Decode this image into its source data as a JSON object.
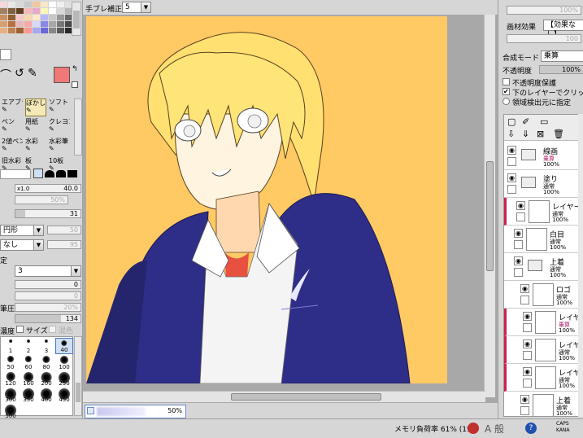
{
  "top_bar": {
    "stabilizer_label": "手ブレ補正",
    "stabilizer_value": "5"
  },
  "left_panel": {
    "swatch_colors": [
      "#f8d8d8",
      "#e8e8e8",
      "#d8d8d8",
      "#c8c8c8",
      "#f0c8a0",
      "#f8e8c8",
      "#ffffff",
      "#f0f0f0",
      "#e0e0e0",
      "#a08060",
      "#806040",
      "#604020",
      "#f8b8b8",
      "#e8a8c8",
      "#f8f8b8",
      "#ffffff",
      "#d8d8d8",
      "#b8b8b8",
      "#c89060",
      "#906030",
      "#f8c8c8",
      "#f8d8a8",
      "#ffe8c8",
      "#b8b8f8",
      "#c8c8c8",
      "#989898",
      "#686868",
      "#d8a070",
      "#b87040",
      "#e8b8b8",
      "#f8a8a8",
      "#d8d8f8",
      "#8888e8",
      "#a8a8a8",
      "#787878",
      "#484848",
      "#e8b080",
      "#c08050",
      "#a06030",
      "#f89898",
      "#a8a8f0",
      "#6868d8",
      "#888888",
      "#585858",
      "#282828"
    ],
    "main_color": "#f07878",
    "tools": [
      {
        "label": "エアブラシ",
        "active": false
      },
      {
        "label": "ぼかし",
        "active": true
      },
      {
        "label": "ソフト",
        "active": false
      },
      {
        "label": "ペン",
        "active": false
      },
      {
        "label": "用紙",
        "active": false
      },
      {
        "label": "クレヨン",
        "active": false
      },
      {
        "label": "2値ペン",
        "active": false
      },
      {
        "label": "水彩",
        "active": false
      },
      {
        "label": "水彩筆",
        "active": false
      },
      {
        "label": "旧水彩",
        "active": false
      },
      {
        "label": "板",
        "active": false
      },
      {
        "label": "10板",
        "active": false
      }
    ],
    "size_multiplier": "x1.0",
    "size_value": "40.0",
    "min_size_value": "50%",
    "density_value": "31",
    "shape_select": "円形",
    "shape_strength": "50",
    "texture_select": "なし",
    "texture_strength": "95",
    "blend_label": "定",
    "blend_value": "3",
    "slider_a_value": "0",
    "slider_b_value": "0",
    "pressure_label": "筆圧",
    "pressure_value": "20%",
    "pressure2_value": "134",
    "density_label": "濃度",
    "size_check_label": "サイズ",
    "mix_check_label": "混色",
    "brush_sizes": [
      "1",
      "2",
      "3",
      "40",
      "50",
      "60",
      "80",
      "100",
      "120",
      "160",
      "200",
      "250",
      "300",
      "350",
      "400",
      "450",
      "500"
    ]
  },
  "navigator": {
    "zoom_pct": "50%"
  },
  "right_panel": {
    "top_slider_value": "100%",
    "paper_effect_label": "画材効果",
    "paper_effect_value": "【効果なし】",
    "paper_strength_value": "100",
    "blend_mode_label": "合成モード",
    "blend_mode_value": "乗算",
    "opacity_label": "不透明度",
    "opacity_value": "100%",
    "protect_opacity_label": "不透明度保護",
    "clip_label": "下のレイヤーでクリッピング",
    "selection_source_label": "領域検出元に指定",
    "layers": [
      {
        "name": "線画",
        "mode": "乗算",
        "opacity": "100%",
        "folder": true,
        "red": false,
        "indent": 0
      },
      {
        "name": "塗り",
        "mode": "通常",
        "opacity": "100%",
        "folder": true,
        "red": false,
        "indent": 0
      },
      {
        "name": "レイヤー",
        "mode": "通常",
        "opacity": "100%",
        "folder": false,
        "red": true,
        "indent": 1
      },
      {
        "name": "白目",
        "mode": "通常",
        "opacity": "100%",
        "folder": false,
        "red": false,
        "indent": 1
      },
      {
        "name": "上着",
        "mode": "通常",
        "opacity": "100%",
        "folder": true,
        "red": false,
        "indent": 1
      },
      {
        "name": "ロゴ",
        "mode": "通常",
        "opacity": "100%",
        "folder": false,
        "red": false,
        "indent": 2
      },
      {
        "name": "レイヤー",
        "mode": "乗算",
        "opacity": "100%",
        "folder": false,
        "red": true,
        "indent": 2
      },
      {
        "name": "レイヤー",
        "mode": "通常",
        "opacity": "100%",
        "folder": false,
        "red": true,
        "indent": 2
      },
      {
        "name": "レイヤー",
        "mode": "通常",
        "opacity": "100%",
        "folder": false,
        "red": true,
        "indent": 2
      },
      {
        "name": "上着",
        "mode": "通常",
        "opacity": "100%",
        "folder": false,
        "red": false,
        "indent": 2
      }
    ]
  },
  "status_bar": {
    "memory_label": "メモリ負荷率 61% (19",
    "ime_text": "A 般",
    "caps_label": "CAPS",
    "kana_label": "KANA"
  },
  "colors": {
    "canvas_bg": "#ffc964",
    "jacket": "#2e2e88",
    "hair": "#ffe070",
    "skin": "#fff0d8",
    "accent_red": "#d0204a"
  }
}
